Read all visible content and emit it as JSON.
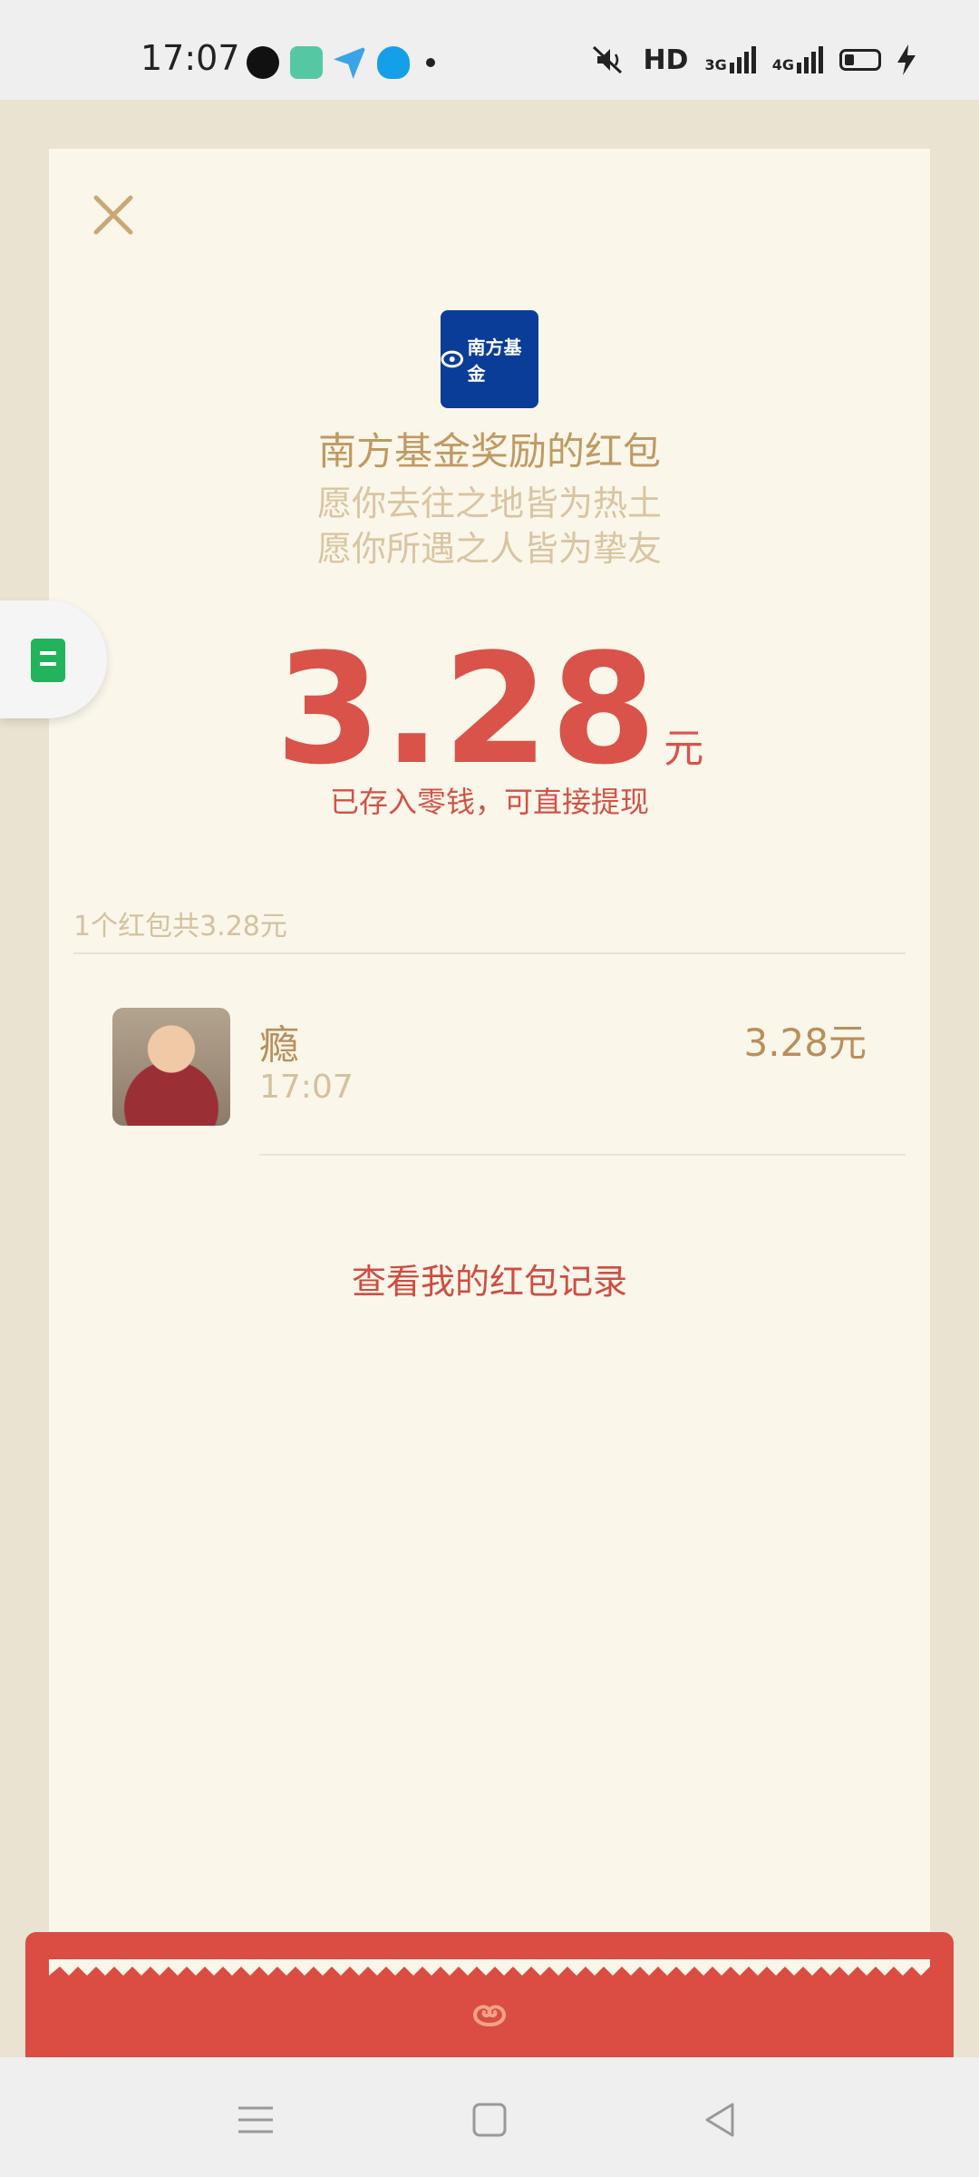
{
  "status_bar": {
    "time": "17:07",
    "network": "HD",
    "signal_1": "3G",
    "signal_2": "4G"
  },
  "card": {
    "logo_text": "南方基金",
    "title": "南方基金奖励的红包",
    "blessing_line1": "愿你去往之地皆为热土",
    "blessing_line2": "愿你所遇之人皆为挚友",
    "amount": "3.28",
    "unit": "元",
    "stored_note": "已存入零钱，可直接提现",
    "summary": "1个红包共3.28元",
    "record": {
      "name": "瘾",
      "time": "17:07",
      "amount": "3.28元"
    },
    "history_link": "查看我的红包记录"
  },
  "colors": {
    "accent_red": "#d9534a",
    "gold": "#bf9a62",
    "card_bg": "#faf6ea"
  }
}
